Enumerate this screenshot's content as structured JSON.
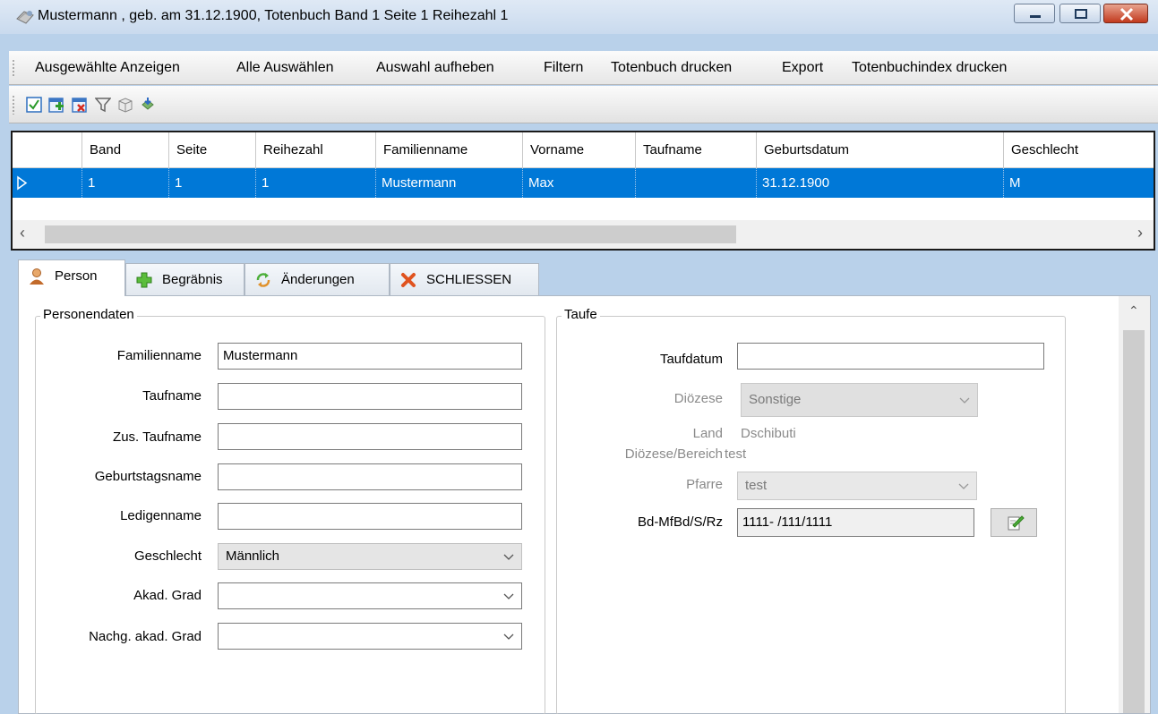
{
  "window": {
    "title": "Mustermann , geb. am 31.12.1900, Totenbuch Band 1 Seite 1 Reihezahl 1",
    "icons": [
      "app-book-icon",
      "minimize-icon",
      "maximize-icon",
      "close-icon"
    ],
    "accent_color": "#0078d7",
    "close_color": "#c23a1e"
  },
  "menu": {
    "items": [
      "Ausgewählte Anzeigen",
      "Alle Auswählen",
      "Auswahl aufheben",
      "Filtern",
      "Totenbuch drucken",
      "Export",
      "Totenbuchindex drucken"
    ]
  },
  "toolbar": {
    "icons": [
      "checkbox-icon",
      "add-record-icon",
      "delete-record-icon",
      "filter-icon",
      "export-box-icon",
      "print-icon"
    ]
  },
  "grid": {
    "columns": [
      "Band",
      "Seite",
      "Reihezahl",
      "Familienname",
      "Vorname",
      "Taufname",
      "Geburtsdatum",
      "Geschlecht"
    ],
    "rows": [
      [
        "1",
        "1",
        "1",
        "Mustermann",
        "Max",
        "",
        "31.12.1900",
        "M"
      ]
    ]
  },
  "tabs": [
    {
      "label": "Person",
      "icon": "person-icon"
    },
    {
      "label": "Begräbnis",
      "icon": "plus-icon"
    },
    {
      "label": "Änderungen",
      "icon": "refresh-icon"
    },
    {
      "label": "SCHLIESSEN",
      "icon": "close-x-icon"
    }
  ],
  "person": {
    "group_title": "Personendaten",
    "familienname_label": "Familienname",
    "familienname_value": "Mustermann",
    "taufname_label": "Taufname",
    "taufname_value": "",
    "zus_taufname_label": "Zus. Taufname",
    "zus_taufname_value": "",
    "geburtstagsname_label": "Geburtstagsname",
    "geburtstagsname_value": "",
    "ledigenname_label": "Ledigenname",
    "ledigenname_value": "",
    "geschlecht_label": "Geschlecht",
    "geschlecht_value": "Männlich",
    "akad_grad_label": "Akad. Grad",
    "akad_grad_value": "",
    "nachg_akad_grad_label": "Nachg. akad. Grad",
    "nachg_akad_grad_value": ""
  },
  "taufe": {
    "group_title": "Taufe",
    "taufdatum_label": "Taufdatum",
    "taufdatum_value": "",
    "dioezese_label": "Diözese",
    "dioezese_value": "Sonstige",
    "land_label": "Land",
    "land_value": "Dschibuti",
    "dioezese_bereich_label": "Diözese/Bereich",
    "dioezese_bereich_value": "test",
    "pfarre_label": "Pfarre",
    "pfarre_value": "test",
    "bd_label": "Bd-MfBd/S/Rz",
    "bd_value": "1111- /111/1111"
  }
}
